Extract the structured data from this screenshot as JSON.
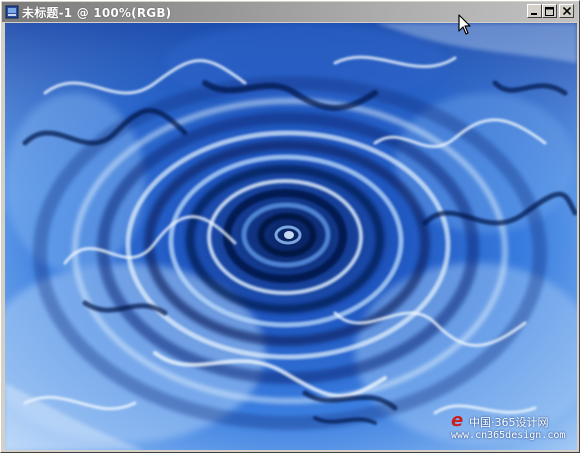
{
  "window": {
    "title": "未标题-1 @ 100%(RGB)",
    "icon": "document-icon",
    "controls": {
      "minimize": "minimize-icon",
      "maximize": "maximize-icon",
      "close": "close-icon"
    }
  },
  "canvas": {
    "content": "blue water ripple swirl filter effect",
    "colors": {
      "deep": "#0a2a7a",
      "mid": "#2a6ad8",
      "light": "#9cc4f4",
      "highlight": "#e8f4ff"
    }
  },
  "watermark": {
    "logo": "e",
    "line1": "中国·365设计网",
    "line2": "www.cn365design.com"
  },
  "cursor": {
    "icon": "arrow-cursor-icon"
  }
}
